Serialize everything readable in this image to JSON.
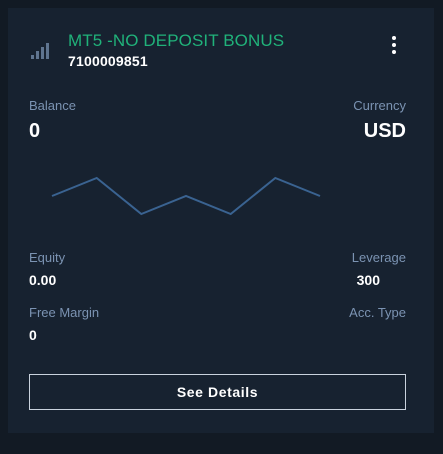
{
  "account": {
    "title": "MT5 -NO DEPOSIT BONUS",
    "number": "7100009851",
    "title_color": "#20b27a"
  },
  "icons": {
    "signal": "signal-bars-icon",
    "menu": "kebab-menu-icon"
  },
  "balance": {
    "label": "Balance",
    "value": "0"
  },
  "currency": {
    "label": "Currency",
    "value": "USD"
  },
  "sparkline": {
    "values": [
      0.5,
      1,
      0,
      0.5,
      0,
      1,
      0.5
    ],
    "color": "#3a6391"
  },
  "equity": {
    "label": "Equity",
    "value": "0.00"
  },
  "leverage": {
    "label": "Leverage",
    "value": "300"
  },
  "free_margin": {
    "label": "Free Margin",
    "value": "0"
  },
  "acc_type": {
    "label": "Acc. Type",
    "value": ""
  },
  "actions": {
    "details_label": "See Details"
  }
}
